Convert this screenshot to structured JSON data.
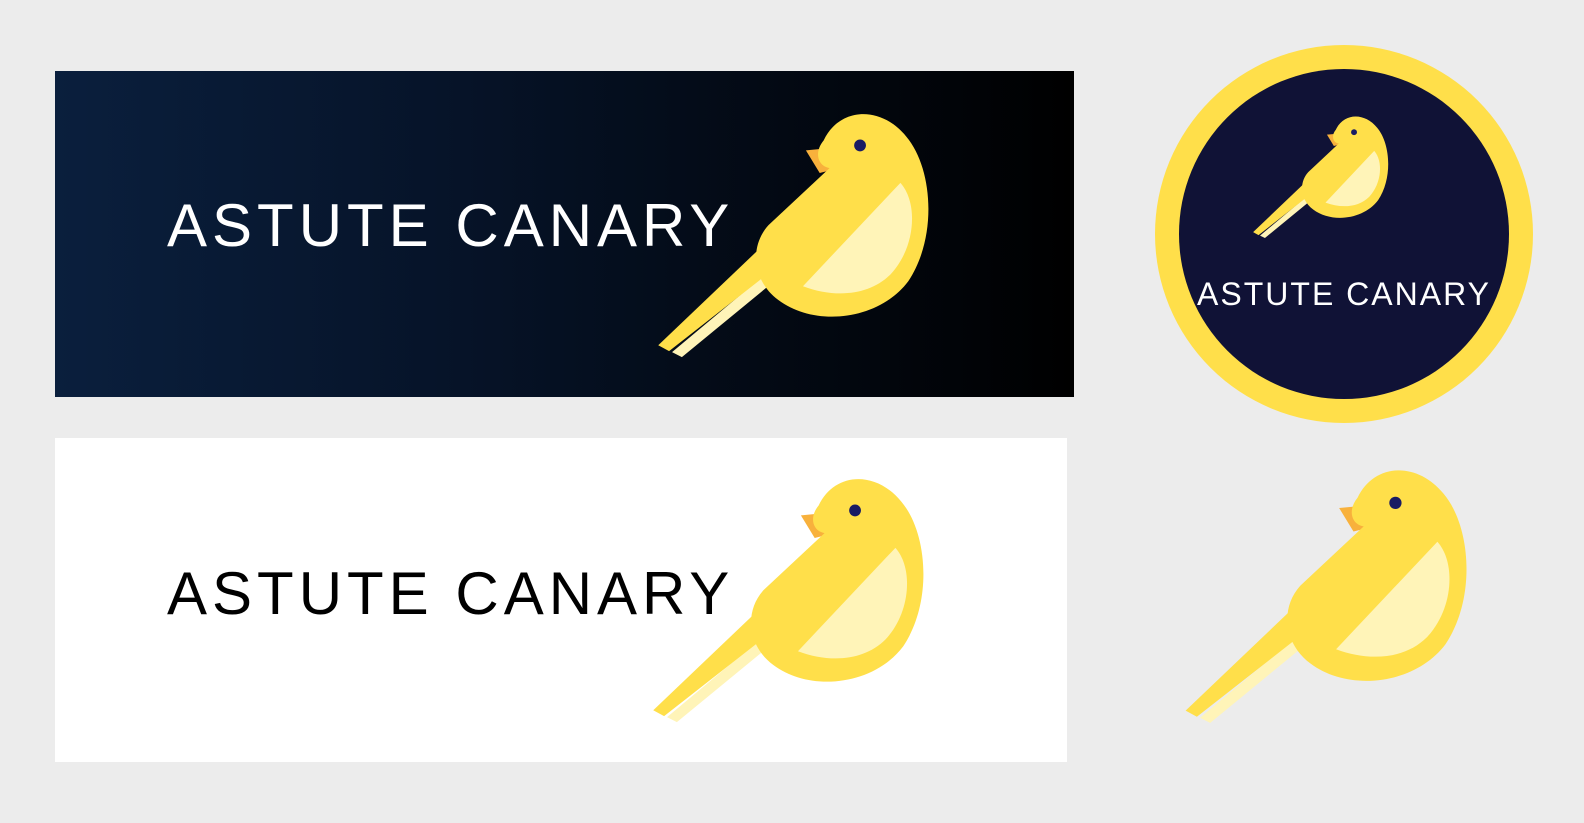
{
  "brand": {
    "name": "ASTUTE CANARY",
    "colors": {
      "canvas": "#ececec",
      "dark_gradient_start": "#0a1f3d",
      "dark_gradient_end": "#000000",
      "light_panel": "#ffffff",
      "badge_ring": "#ffdf4a",
      "badge_fill": "#101236",
      "bird_body": "#ffdf4a",
      "bird_wing": "#fff4b8",
      "bird_beak": "#f8b13c",
      "bird_eye": "#191b63"
    }
  },
  "logos": [
    {
      "variant": "horizontal-dark",
      "wordmark": "ASTUTE CANARY",
      "icon": "canary-bird-icon"
    },
    {
      "variant": "circular-badge",
      "wordmark": "ASTUTE CANARY",
      "icon": "canary-bird-icon"
    },
    {
      "variant": "horizontal-light",
      "wordmark": "ASTUTE CANARY",
      "icon": "canary-bird-icon"
    },
    {
      "variant": "icon-only",
      "icon": "canary-bird-icon"
    }
  ]
}
